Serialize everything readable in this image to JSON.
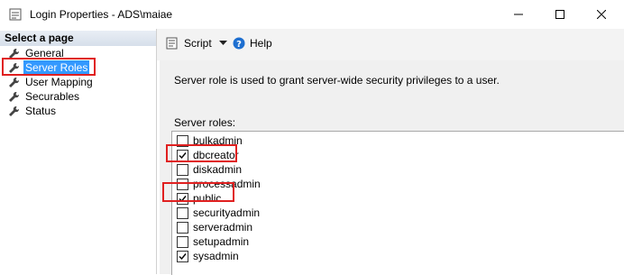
{
  "window": {
    "title": "Login Properties - ADS\\maiae"
  },
  "sidebar": {
    "header": "Select a page",
    "items": [
      {
        "label": "General",
        "selected": false
      },
      {
        "label": "Server Roles",
        "selected": true
      },
      {
        "label": "User Mapping",
        "selected": false
      },
      {
        "label": "Securables",
        "selected": false
      },
      {
        "label": "Status",
        "selected": false
      }
    ]
  },
  "toolbar": {
    "script_label": "Script",
    "help_label": "Help"
  },
  "main": {
    "description": "Server role is used to grant server-wide security privileges to a user.",
    "roles_label": "Server roles:",
    "roles": [
      {
        "name": "bulkadmin",
        "checked": false
      },
      {
        "name": "dbcreator",
        "checked": true
      },
      {
        "name": "diskadmin",
        "checked": false
      },
      {
        "name": "processadmin",
        "checked": false
      },
      {
        "name": "public",
        "checked": true
      },
      {
        "name": "securityadmin",
        "checked": false
      },
      {
        "name": "serveradmin",
        "checked": false
      },
      {
        "name": "setupadmin",
        "checked": false
      },
      {
        "name": "sysadmin",
        "checked": true
      }
    ]
  },
  "colors": {
    "selection": "#3399ff",
    "annotation": "#e02020",
    "help_icon": "#1e6fd0"
  }
}
